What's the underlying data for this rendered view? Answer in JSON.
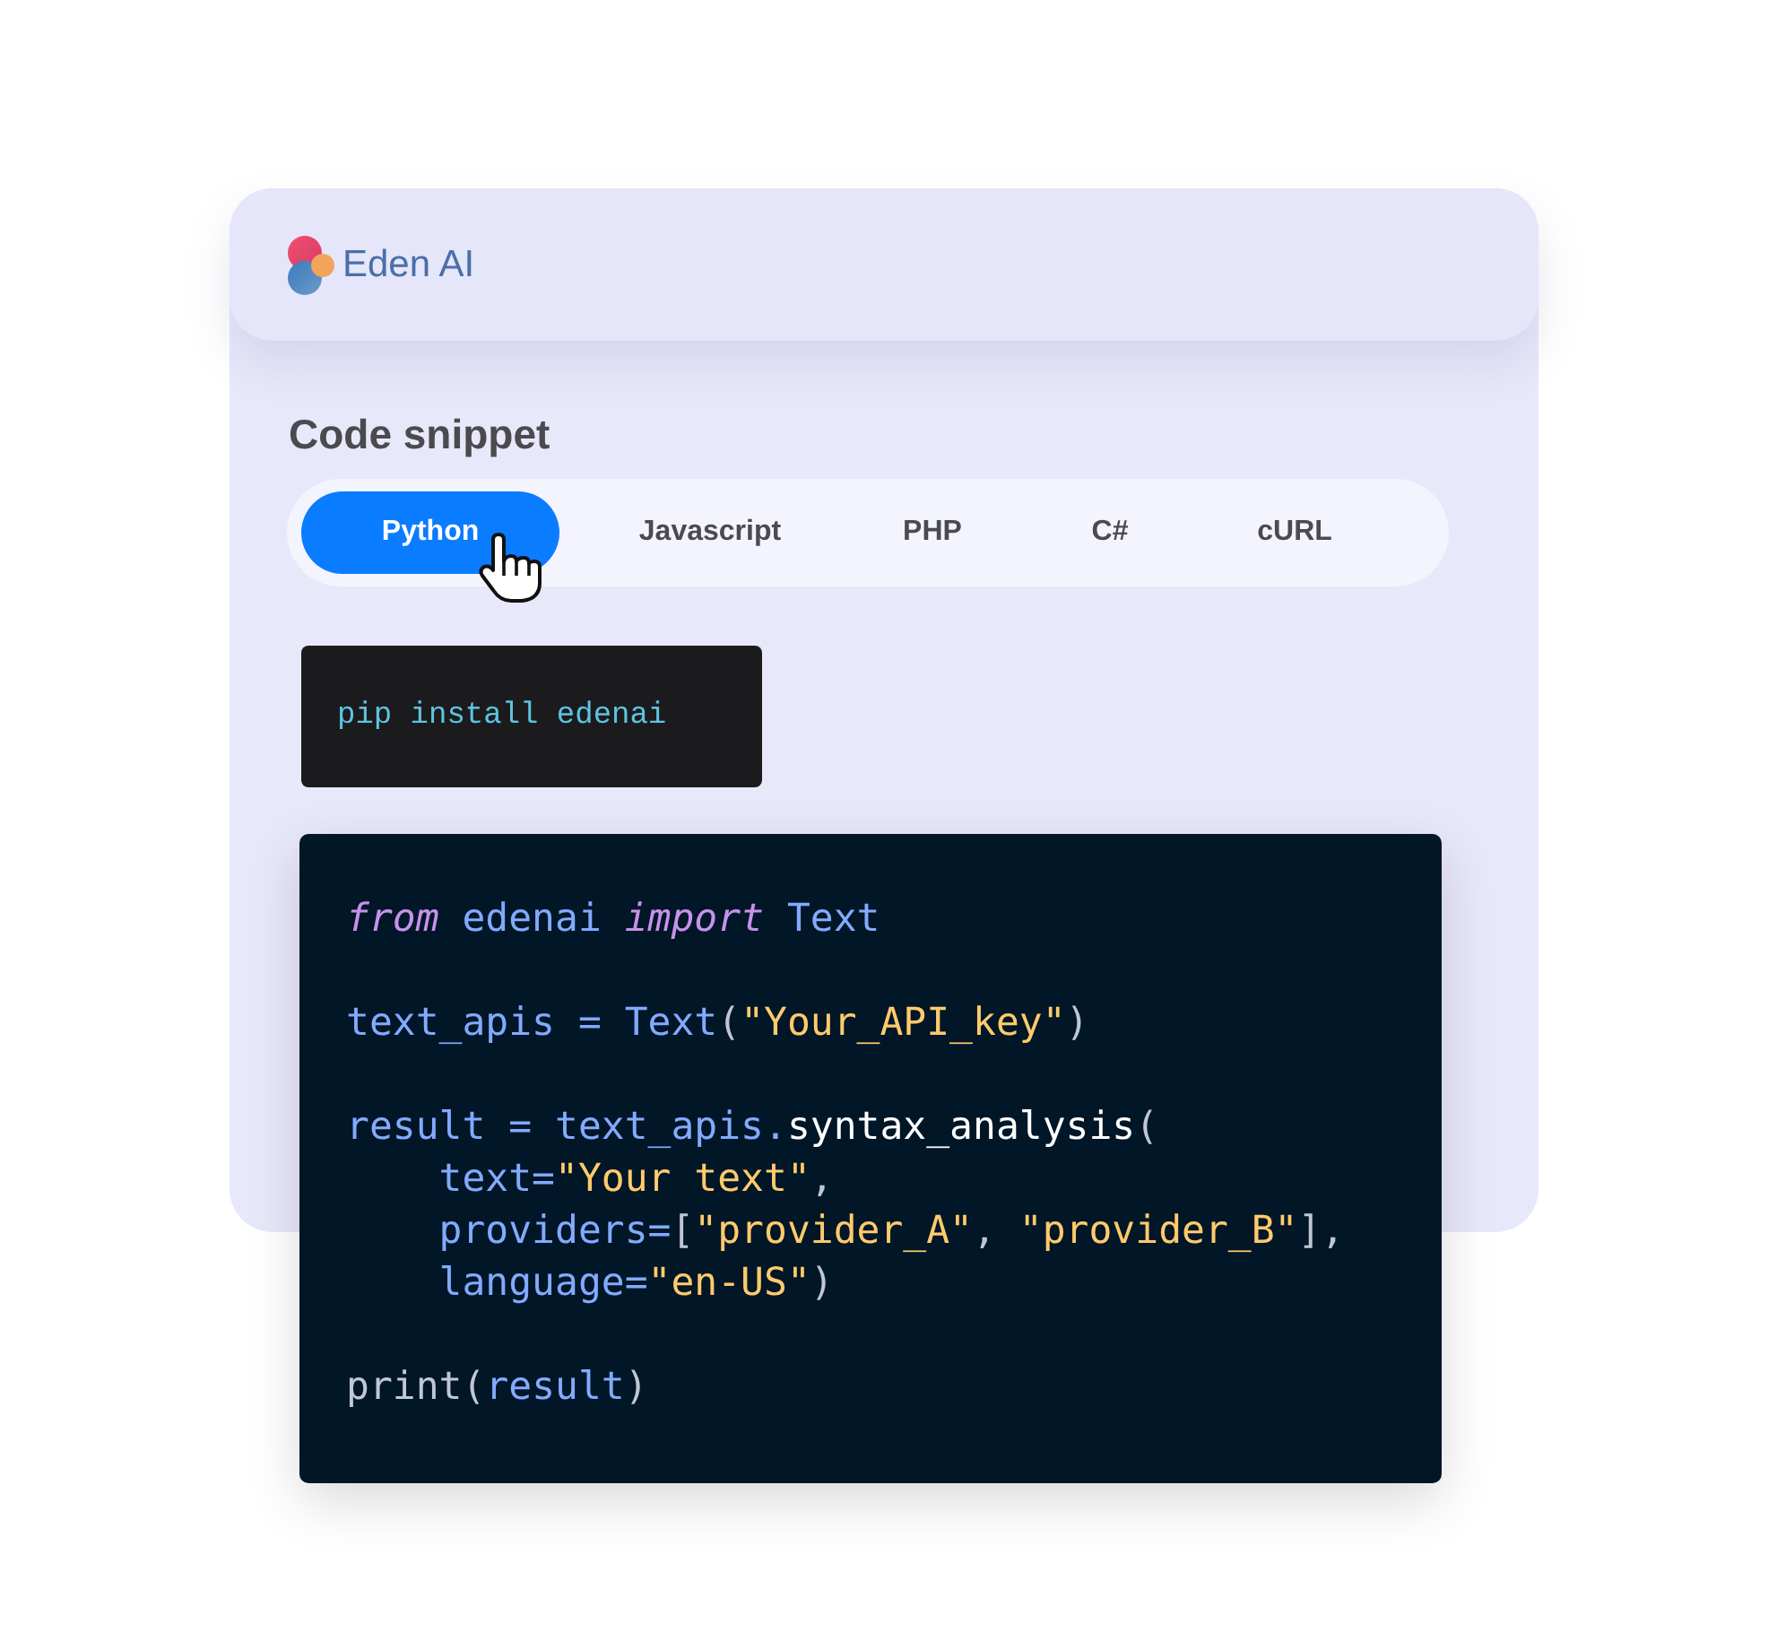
{
  "brand": {
    "name": "Eden AI"
  },
  "section_title": "Code snippet",
  "tabs": [
    {
      "label": "Python",
      "selected": true
    },
    {
      "label": "Javascript",
      "selected": false
    },
    {
      "label": "PHP",
      "selected": false
    },
    {
      "label": "C#",
      "selected": false
    },
    {
      "label": "cURL",
      "selected": false
    }
  ],
  "install_command": "pip install edenai",
  "code_lines": [
    {
      "kind": "code",
      "tokens": [
        {
          "text": "from",
          "kind": "keyword"
        },
        {
          "text": " edenai ",
          "kind": "name"
        },
        {
          "text": "import",
          "kind": "keyword"
        },
        {
          "text": " Text",
          "kind": "name"
        }
      ]
    },
    {
      "kind": "blank"
    },
    {
      "kind": "code",
      "tokens": [
        {
          "text": "text_apis = Text",
          "kind": "name"
        },
        {
          "text": "(",
          "kind": "punct"
        },
        {
          "text": "\"Your_API_key\"",
          "kind": "string"
        },
        {
          "text": ")",
          "kind": "punct"
        }
      ]
    },
    {
      "kind": "blank"
    },
    {
      "kind": "code",
      "tokens": [
        {
          "text": "result = text_apis.",
          "kind": "name"
        },
        {
          "text": "syntax_analysis",
          "kind": "call"
        },
        {
          "text": "(",
          "kind": "punct"
        }
      ]
    },
    {
      "kind": "code",
      "tokens": [
        {
          "text": "    text=",
          "kind": "name"
        },
        {
          "text": "\"Your text\"",
          "kind": "string"
        },
        {
          "text": ",",
          "kind": "punct"
        }
      ]
    },
    {
      "kind": "code",
      "tokens": [
        {
          "text": "    providers=",
          "kind": "name"
        },
        {
          "text": "[",
          "kind": "punct"
        },
        {
          "text": "\"provider_A\"",
          "kind": "string"
        },
        {
          "text": ", ",
          "kind": "punct"
        },
        {
          "text": "\"provider_B\"",
          "kind": "string"
        },
        {
          "text": "],",
          "kind": "punct"
        }
      ]
    },
    {
      "kind": "code",
      "tokens": [
        {
          "text": "    language=",
          "kind": "name"
        },
        {
          "text": "\"en-US\"",
          "kind": "string"
        },
        {
          "text": ")",
          "kind": "punct"
        }
      ]
    },
    {
      "kind": "blank"
    },
    {
      "kind": "code",
      "tokens": [
        {
          "text": "print",
          "kind": "punct"
        },
        {
          "text": "(",
          "kind": "punct"
        },
        {
          "text": "result",
          "kind": "name"
        },
        {
          "text": ")",
          "kind": "punct"
        }
      ]
    }
  ]
}
